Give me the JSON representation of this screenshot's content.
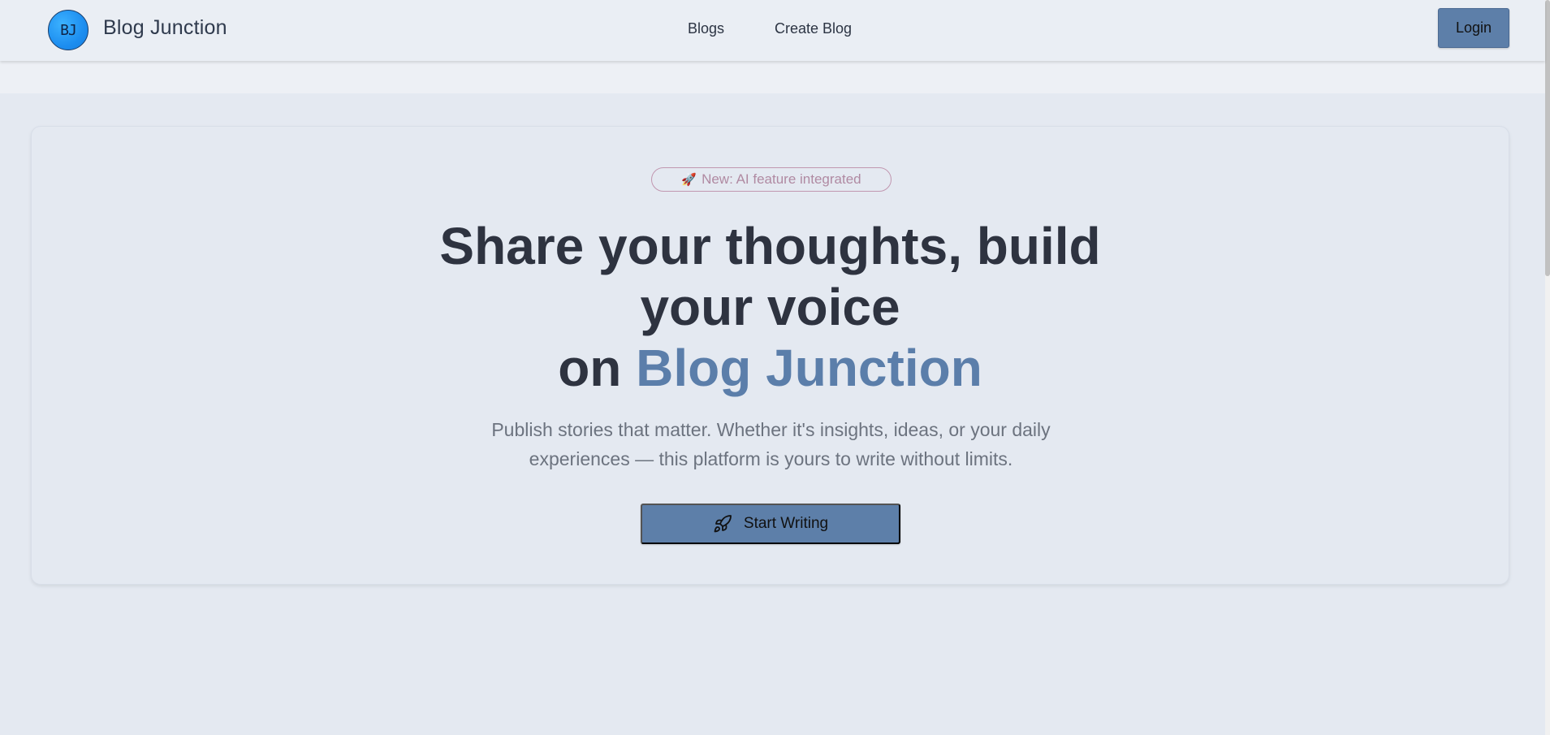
{
  "header": {
    "logo_text": "BJ",
    "brand": "Blog Junction",
    "nav": [
      {
        "label": "Blogs"
      },
      {
        "label": "Create Blog"
      }
    ],
    "login_label": "Login"
  },
  "hero": {
    "badge_text": "New: AI feature integrated",
    "badge_icon": "rocket-icon",
    "headline_line1": "Share your thoughts, build",
    "headline_line2": "your voice",
    "headline_on": "on",
    "headline_accent": "Blog Junction",
    "subtext": "Publish stories that matter. Whether it's insights, ideas, or your daily experiences — this platform is yours to write without limits.",
    "cta_label": "Start Writing",
    "cta_icon": "rocket-icon"
  },
  "colors": {
    "accent": "#5b7eaa",
    "button": "#5d7fa9",
    "badge_border": "#c197b0",
    "badge_text": "#b08aa2",
    "heading": "#2e3340",
    "background": "#e4e9f1"
  }
}
